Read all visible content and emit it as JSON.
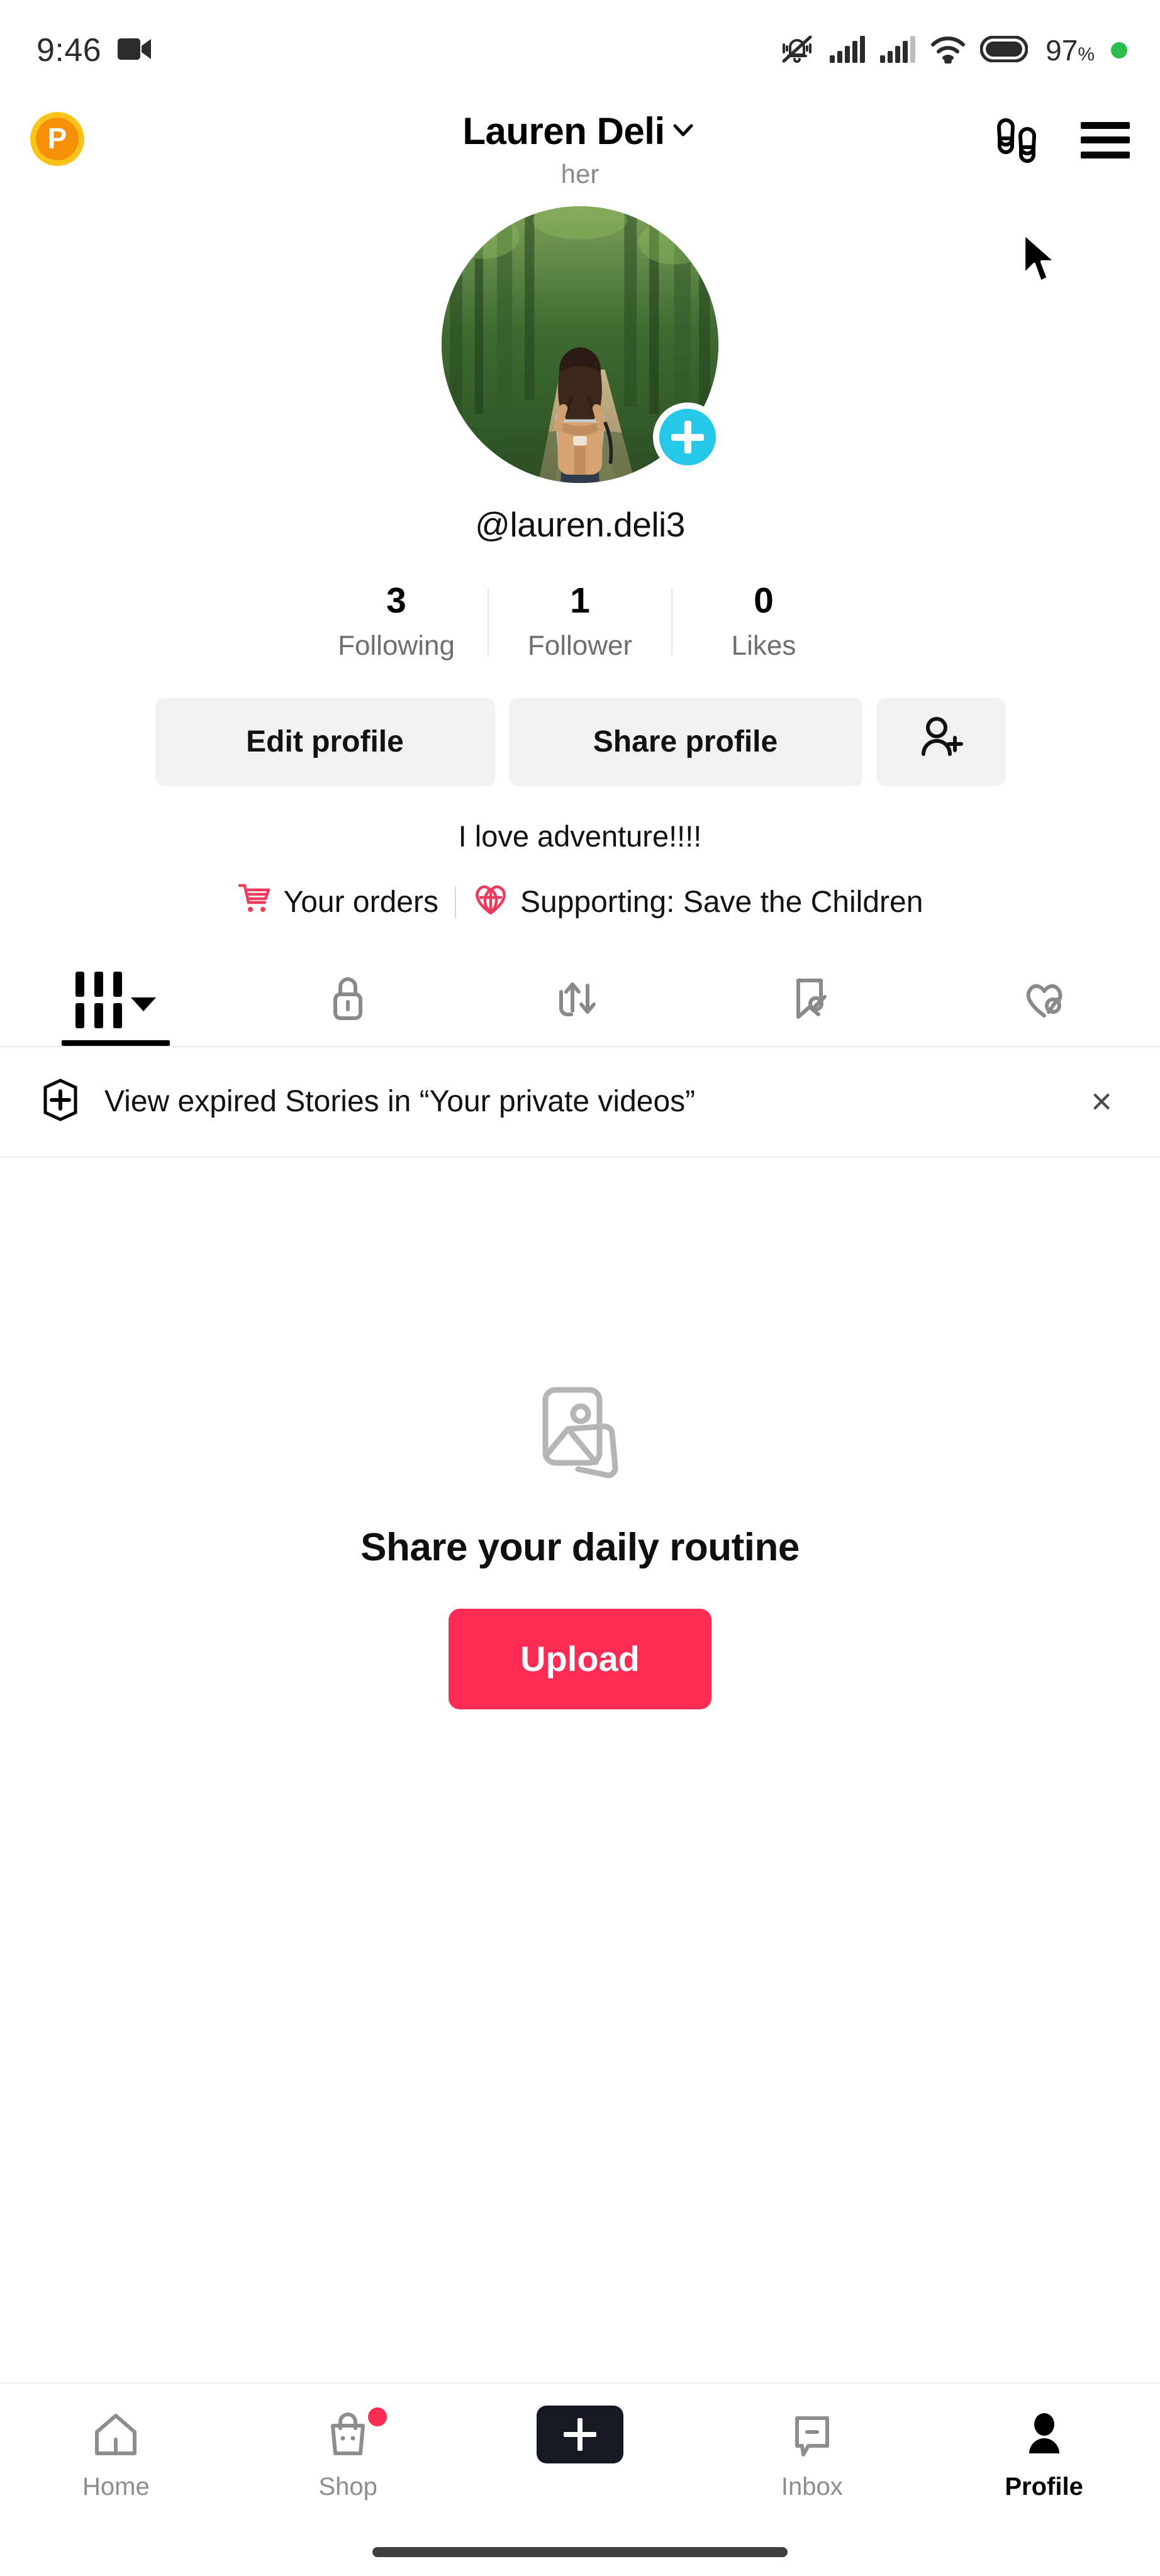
{
  "status_bar": {
    "time": "9:46",
    "video_icon": "video-camera-icon",
    "vibrate_icon": "vibrate-off-icon",
    "signal_1_icon": "cellular-signal-icon",
    "signal_2_icon": "cellular-signal-icon",
    "wifi_icon": "wifi-icon",
    "battery_icon": "battery-icon",
    "battery_percent": "97",
    "battery_symbol": "%",
    "recording_dot": "green-recording-dot"
  },
  "header": {
    "coin_badge_label": "P",
    "coin_ring_color": "#FCC419",
    "coin_center_color": "#F79009",
    "title": "Lauren Deli",
    "title_chevron": "chevron-down-icon",
    "pronoun": "her",
    "footprints_icon": "footprints-icon",
    "menu_icon": "hamburger-menu-icon"
  },
  "profile": {
    "avatar_alt": "hiker-with-backpack-in-forest",
    "add_story_icon": "plus-icon",
    "add_story_color": "#25C8E8",
    "username": "@lauren.deli3"
  },
  "stats": [
    {
      "value": "3",
      "label": "Following"
    },
    {
      "value": "1",
      "label": "Follower"
    },
    {
      "value": "0",
      "label": "Likes"
    }
  ],
  "actions": {
    "edit_label": "Edit profile",
    "share_label": "Share profile",
    "add_friend_icon": "add-person-icon"
  },
  "bio": {
    "text": "I love adventure!!!!"
  },
  "links": {
    "orders_icon": "shopping-cart-icon",
    "orders_label": "Your orders",
    "supporting_icon": "heart-globe-icon",
    "supporting_label": "Supporting: Save the Children",
    "accent_color": "#EE3A5C"
  },
  "tabs": [
    {
      "name": "posts-grid",
      "icon": "grid-icon",
      "active": true,
      "has_caret": true
    },
    {
      "name": "private",
      "icon": "lock-icon",
      "active": false,
      "has_caret": false
    },
    {
      "name": "reposts",
      "icon": "repost-arrows-icon",
      "active": false,
      "has_caret": false
    },
    {
      "name": "saved",
      "icon": "bookmark-slash-icon",
      "active": false,
      "has_caret": false
    },
    {
      "name": "liked",
      "icon": "heart-slash-icon",
      "active": false,
      "has_caret": false
    }
  ],
  "story_banner": {
    "icon": "circle-plus-icon",
    "text": "View expired Stories in “Your private videos”",
    "close_label": "×"
  },
  "empty_state": {
    "icon": "stacked-photos-icon",
    "title": "Share your daily routine",
    "upload_label": "Upload",
    "upload_color": "#FE2C55"
  },
  "bottom_nav": [
    {
      "label": "Home",
      "icon": "home-icon",
      "active": false,
      "badge": false
    },
    {
      "label": "Shop",
      "icon": "shopping-bag-icon",
      "active": false,
      "badge": true
    },
    {
      "label": "",
      "icon": "create-plus-icon",
      "active": false,
      "badge": false
    },
    {
      "label": "Inbox",
      "icon": "message-icon",
      "active": false,
      "badge": false
    },
    {
      "label": "Profile",
      "icon": "person-icon",
      "active": true,
      "badge": false
    }
  ],
  "cursor": {
    "icon": "mouse-pointer-arrow"
  }
}
